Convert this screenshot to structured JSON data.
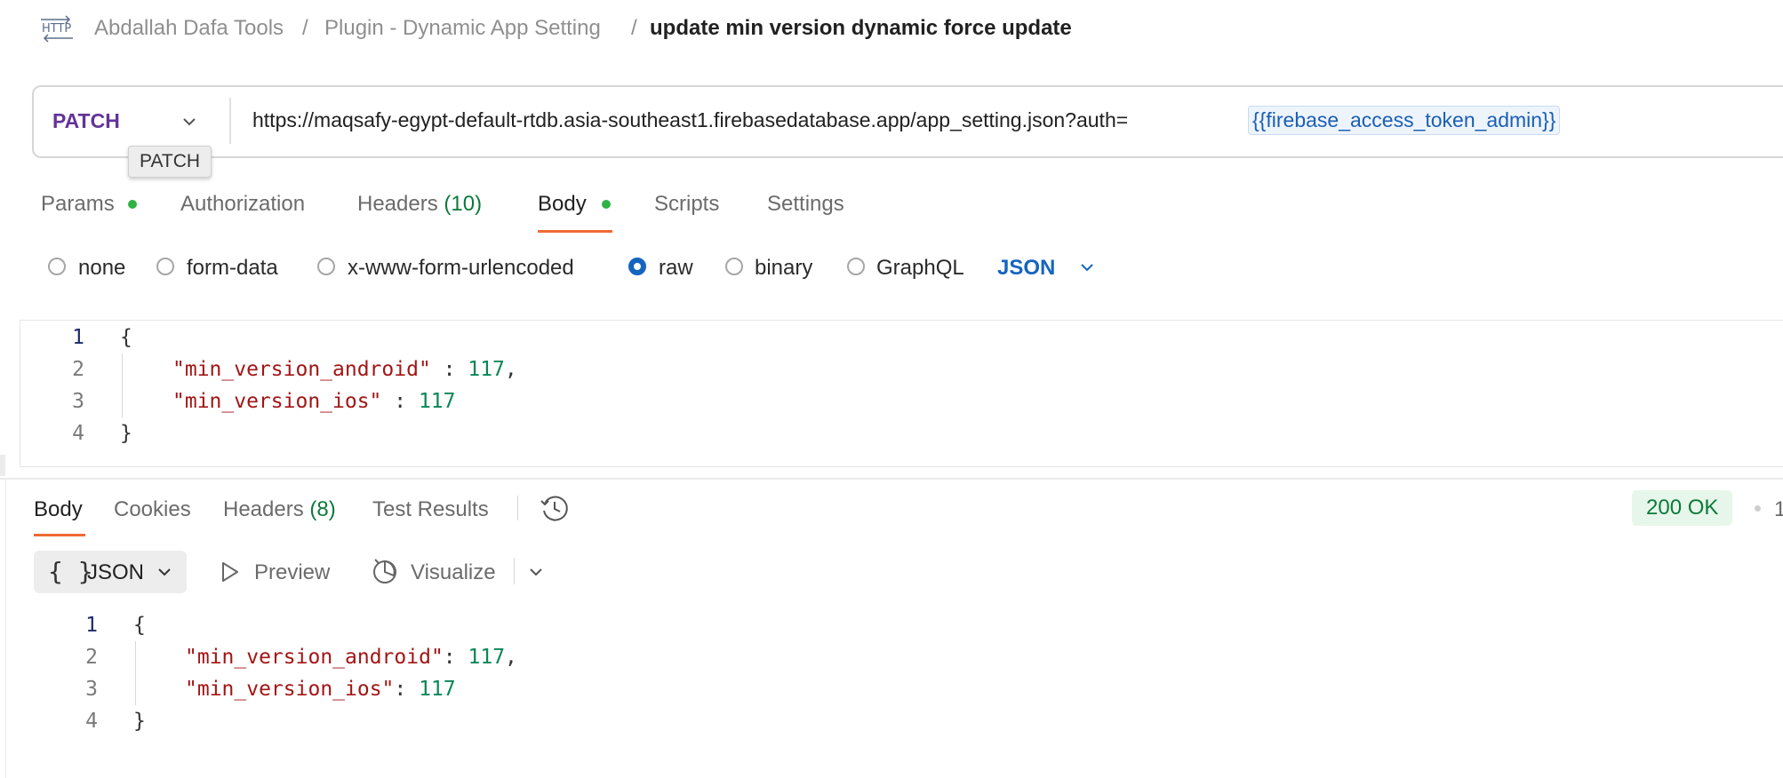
{
  "breadcrumb": {
    "icon": "http-icon",
    "items": [
      "Abdallah Dafa Tools",
      "Plugin - Dynamic App Setting"
    ],
    "separator": "/",
    "current": "update min version dynamic force update"
  },
  "request": {
    "method": "PATCH",
    "method_tooltip": "PATCH",
    "url_base": "https://maqsafy-egypt-default-rtdb.asia-southeast1.firebasedatabase.app/app_setting.json?auth=",
    "url_variable": "{{firebase_access_token_admin}}",
    "tabs": {
      "params": "Params",
      "authorization": "Authorization",
      "headers": "Headers",
      "headers_count": "(10)",
      "body": "Body",
      "scripts": "Scripts",
      "settings": "Settings"
    },
    "body_types": {
      "none": "none",
      "form_data": "form-data",
      "urlencoded": "x-www-form-urlencoded",
      "raw": "raw",
      "binary": "binary",
      "graphql": "GraphQL"
    },
    "selected_body_type": "raw",
    "body_language": "JSON",
    "body_lines": {
      "l1": "{",
      "l2_key": "\"min_version_android\"",
      "l2_sep": " : ",
      "l2_val": "117",
      "l2_end": ",",
      "l3_key": "\"min_version_ios\"",
      "l3_sep": " : ",
      "l3_val": "117",
      "l4": "}"
    },
    "line_numbers": [
      "1",
      "2",
      "3",
      "4"
    ]
  },
  "response": {
    "tabs": {
      "body": "Body",
      "cookies": "Cookies",
      "headers": "Headers",
      "headers_count": "(8)",
      "test_results": "Test Results"
    },
    "status": "200 OK",
    "status_more": "1",
    "format": {
      "braces": "{ }",
      "label": "JSON"
    },
    "preview": "Preview",
    "visualize": "Visualize",
    "body_lines": {
      "l1": "{",
      "l2_key": "\"min_version_android\"",
      "l2_sep": ": ",
      "l2_val": "117",
      "l2_end": ",",
      "l3_key": "\"min_version_ios\"",
      "l3_sep": ": ",
      "l3_val": "117",
      "l4": "}"
    },
    "line_numbers": [
      "1",
      "2",
      "3",
      "4"
    ]
  },
  "colors": {
    "method": "#623497",
    "accent_tab": "#f06a35",
    "link_blue": "#1565c0",
    "status_green": "#0c7a3c",
    "json_string": "#a31515",
    "json_number": "#098658"
  }
}
